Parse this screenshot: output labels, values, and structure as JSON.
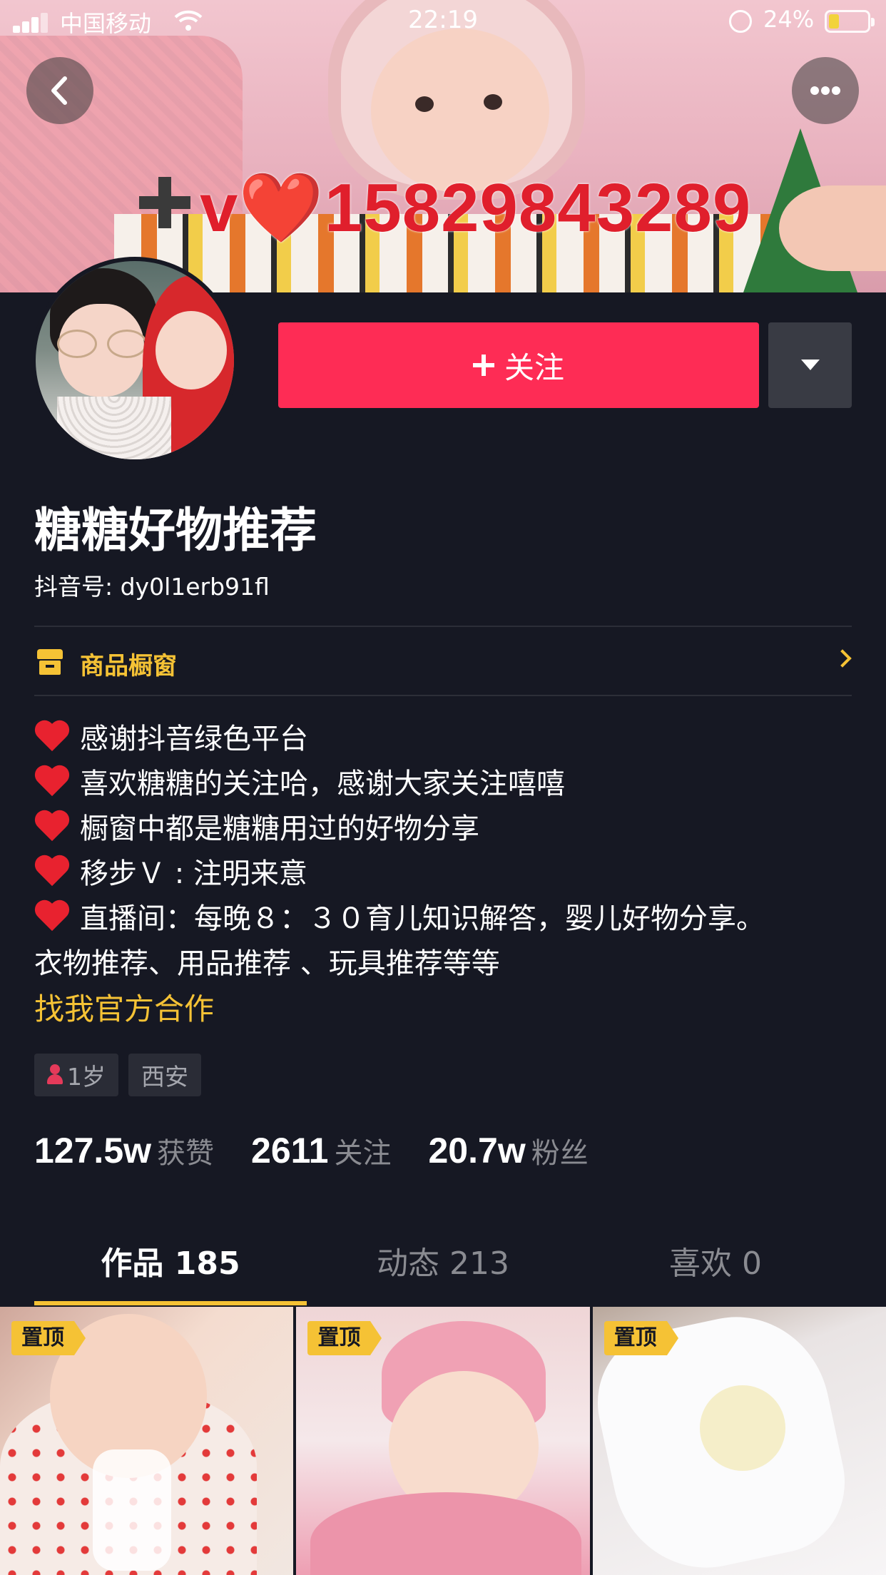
{
  "status_bar": {
    "carrier": "中国移动",
    "time": "22:19",
    "battery": "24%",
    "battery_level": 0.24
  },
  "cover": {
    "overlay_text": "v❤️15829843289"
  },
  "profile": {
    "follow_label": "关注",
    "nickname": "糖糖好物推荐",
    "douyin_id": "抖音号: dy0l1erb91fl",
    "shop_label": "商品橱窗",
    "bio": [
      "感谢抖音绿色平台",
      "喜欢糖糖的关注哈，感谢大家关注嘻嘻",
      "橱窗中都是糖糖用过的好物分享",
      "移步Ｖ : 注明来意",
      "直播间：每晚８：３０育儿知识解答，婴儿好物分享。"
    ],
    "bio_extra": "衣物推荐、用品推荐 、玩具推荐等等",
    "official_link": "找我官方合作",
    "tags": {
      "age": "1岁",
      "location": "西安"
    },
    "stats": {
      "likes": {
        "num": "127.5w",
        "label": "获赞"
      },
      "following": {
        "num": "2611",
        "label": "关注"
      },
      "followers": {
        "num": "20.7w",
        "label": "粉丝"
      }
    }
  },
  "tabs": {
    "works": "作品 185",
    "moments": "动态 213",
    "likes": "喜欢 0"
  },
  "grid": {
    "pin_label": "置顶"
  },
  "colors": {
    "background": "#161823",
    "follow_button": "#fe2c55",
    "accent_yellow": "#f5c235",
    "muted_text": "#8a8b91"
  },
  "icons": [
    "back-icon",
    "more-icon",
    "dropdown-arrow-icon",
    "shop-icon",
    "chevron-right-icon",
    "heart-icon",
    "female-icon",
    "signal-icon",
    "wifi-icon",
    "rotation-lock-icon",
    "battery-icon"
  ]
}
